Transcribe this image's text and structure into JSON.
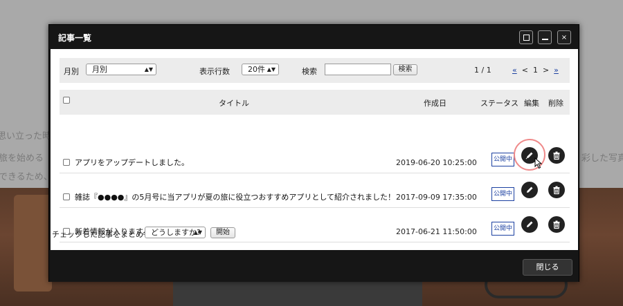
{
  "window": {
    "title": "記事一覧",
    "maximize_label": "",
    "minimize_label": "",
    "close_label": "×"
  },
  "filter": {
    "month_label": "月別",
    "month_value": "月別",
    "rows_label": "表示行数",
    "rows_value": "20件",
    "search_label": "検索",
    "search_value": "",
    "search_button": "検索",
    "page_info": "1 / 1",
    "pager": {
      "first": "«",
      "prev": "<",
      "current": "1",
      "next": ">",
      "last": "»"
    }
  },
  "table": {
    "headers": {
      "title": "タイトル",
      "created": "作成日",
      "status": "ステータス",
      "edit": "編集",
      "delete": "削除"
    },
    "rows": [
      {
        "title": "アプリをアップデートしました。",
        "created": "2019-06-20 10:25:00",
        "status": "公開中"
      },
      {
        "title": "雑誌『●●●●』の5月号に当アプリが夏の旅に役立つおすすめアプリとして紹介されました！",
        "created": "2017-09-09 17:35:00",
        "status": "公開中"
      },
      {
        "title": "新着情報が入ります。",
        "created": "2017-06-21 11:50:00",
        "status": "公開中"
      }
    ]
  },
  "bulk": {
    "label": "チェックした記事をまとめて",
    "select_value": "どうしますか?",
    "start_button": "開始"
  },
  "footer": {
    "close_button": "閉じる"
  },
  "background": {
    "line1": "思い立った時",
    "line2": "旅を始める",
    "line3": "できるため、",
    "line4": "彩した写真"
  },
  "colors": {
    "status_blue": "#1a3fa0",
    "highlight_ring": "#ef8a8a",
    "window_bg": "#161616"
  }
}
